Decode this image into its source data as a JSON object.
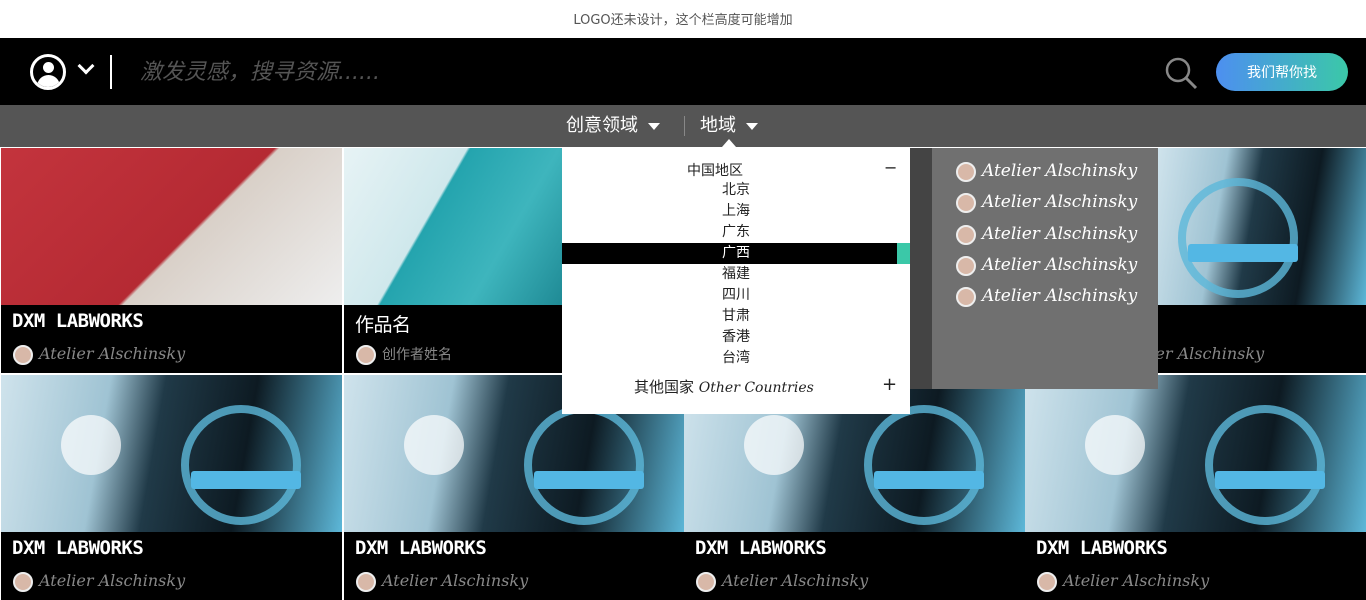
{
  "logo_note": "LOGO还未设计，这个栏高度可能增加",
  "search": {
    "placeholder": "激发灵感，搜寻资源......",
    "find_button": "我们帮你找"
  },
  "filters": [
    {
      "label": "创意领域"
    },
    {
      "label": "地域"
    }
  ],
  "region_dropdown": {
    "group_title": "中国地区",
    "group_toggle": "−",
    "items": [
      "北京",
      "上海",
      "广东",
      "广西",
      "福建",
      "四川",
      "甘肃",
      "香港",
      "台湾"
    ],
    "selected": "广西",
    "other_label_cn": "其他国家",
    "other_label_en": "Other Countries",
    "other_toggle": "+"
  },
  "side_panel": {
    "items": [
      "Atelier Alschinsky",
      "Atelier Alschinsky",
      "Atelier Alschinsky",
      "Atelier Alschinsky",
      "Atelier Alschinsky"
    ]
  },
  "cards": [
    {
      "title": "DXM LABWORKS",
      "author": "Atelier Alschinsky"
    },
    {
      "title": "作品名",
      "author": "创作者姓名"
    },
    {
      "title": "",
      "author": "Atelier Alschinsky"
    },
    {
      "title": "DXM LABWORKS",
      "author": "Atelier Alschinsky"
    },
    {
      "title": "DXM LABWORKS",
      "author": "Atelier Alschinsky"
    },
    {
      "title": "DXM LABWORKS",
      "author": "Atelier Alschinsky"
    },
    {
      "title": "DXM LABWORKS",
      "author": "Atelier Alschinsky"
    }
  ],
  "colors": {
    "accent_teal": "#3bc8a8",
    "accent_blue": "#4d8ff0",
    "topbar": "#000000",
    "filterbar": "#555555"
  }
}
